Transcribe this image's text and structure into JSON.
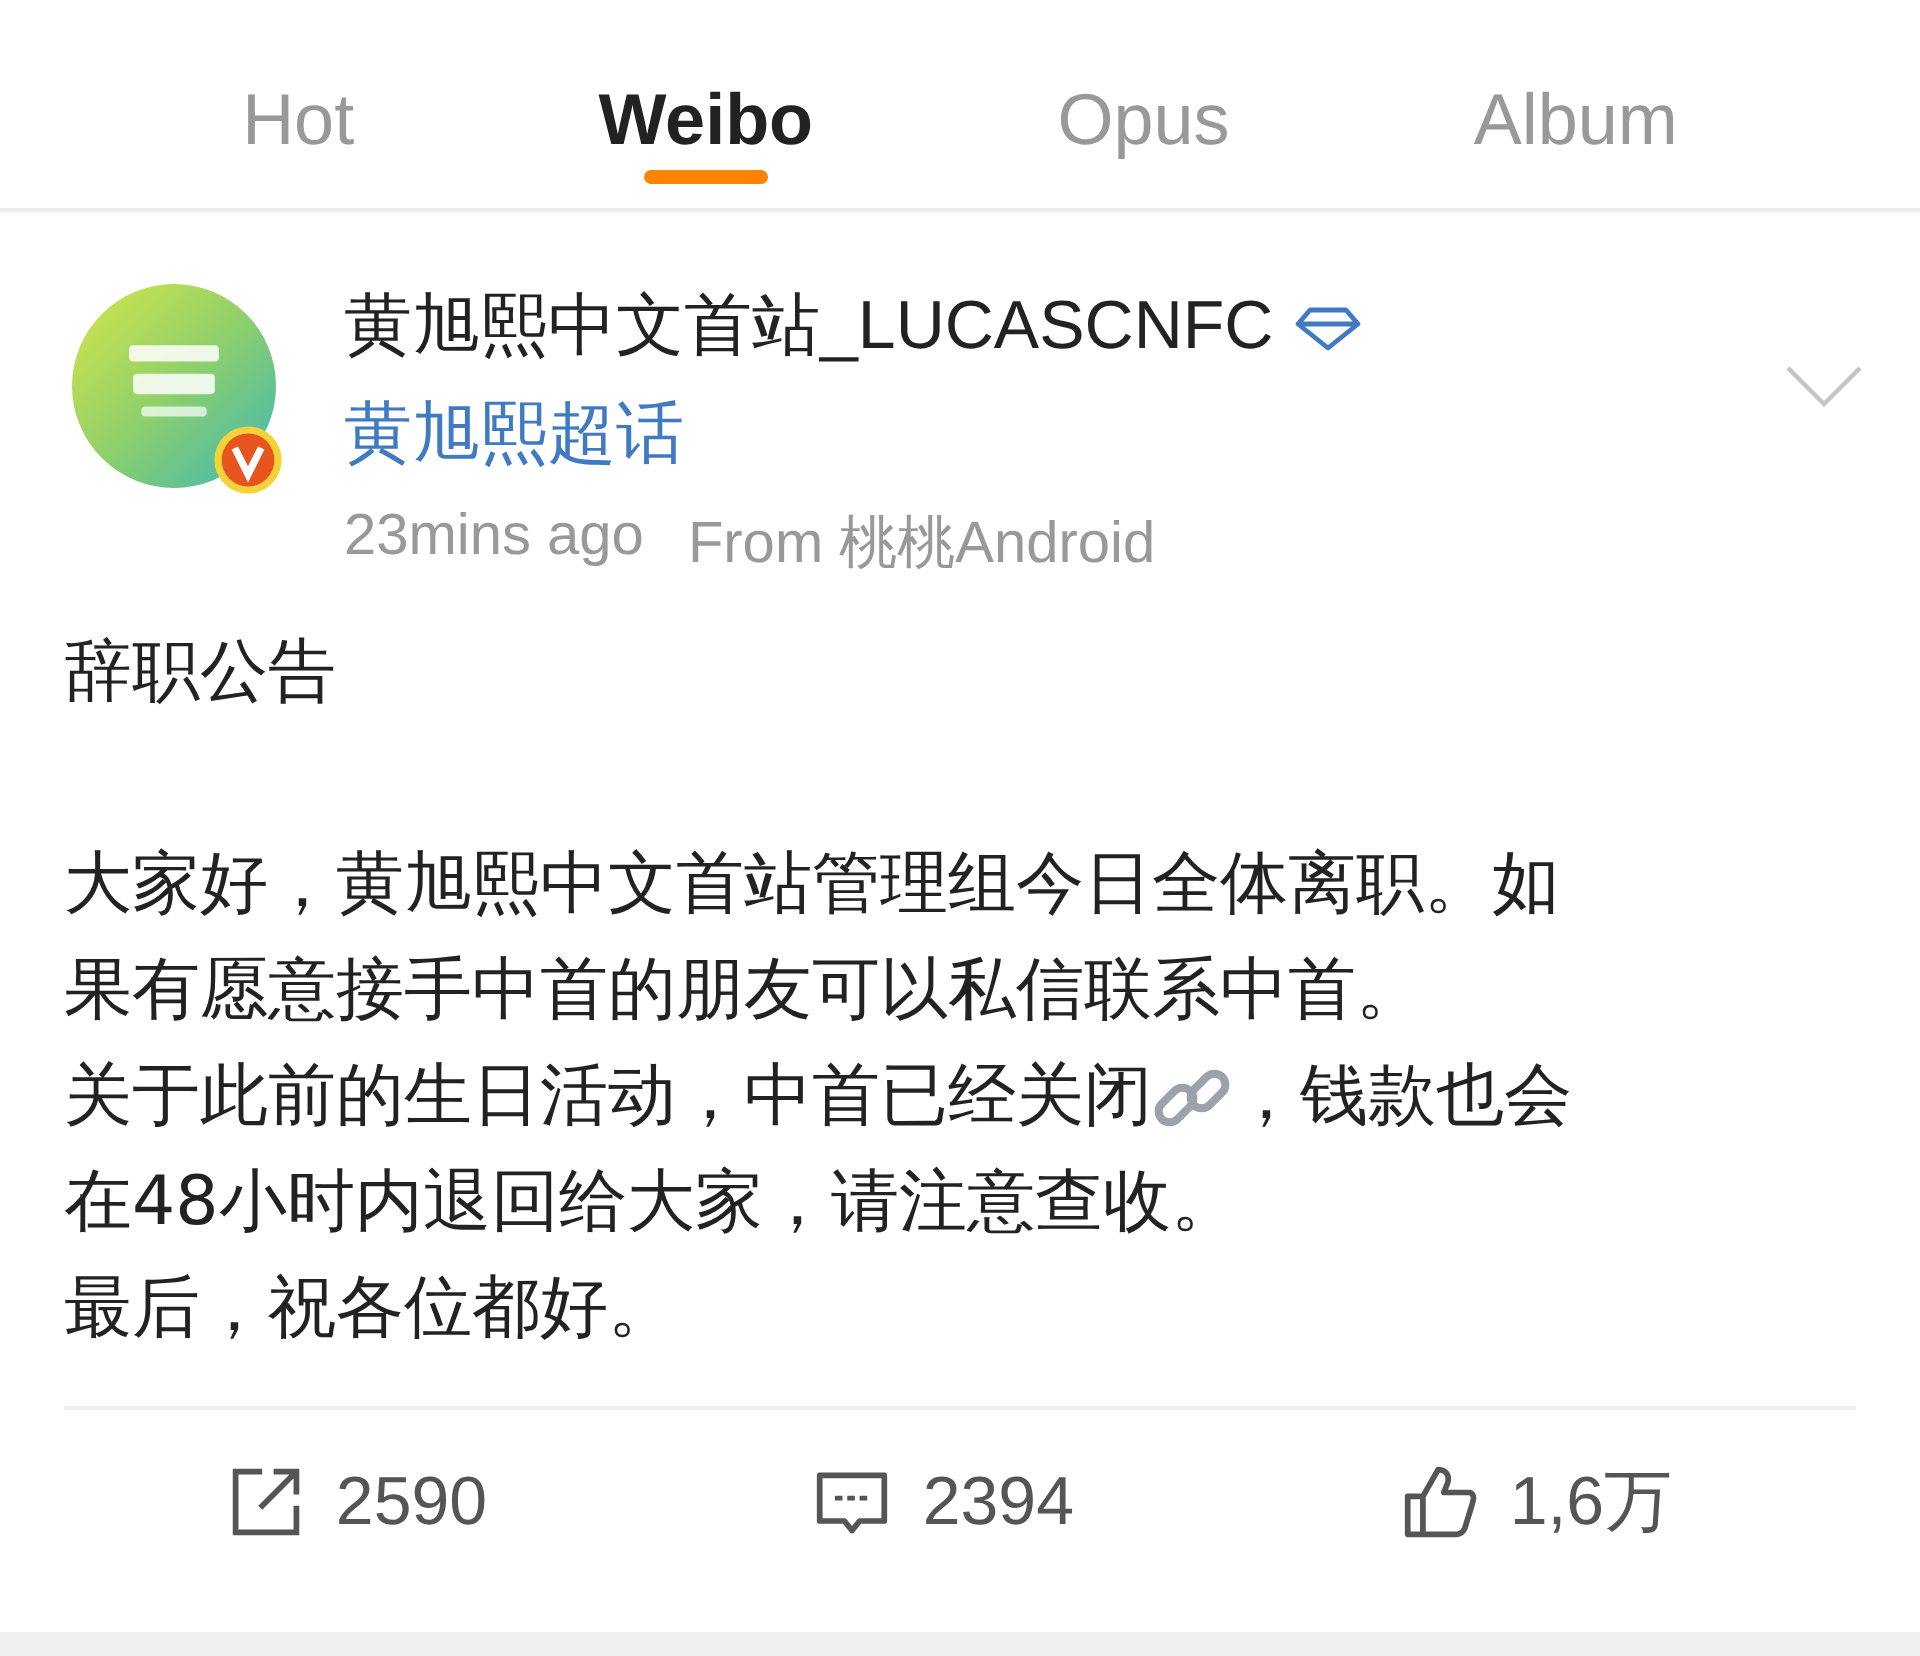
{
  "tabs": [
    {
      "label": "Hot",
      "selected": false
    },
    {
      "label": "Weibo",
      "selected": true
    },
    {
      "label": "Opus",
      "selected": false
    },
    {
      "label": "Album",
      "selected": false
    }
  ],
  "post": {
    "author": "黄旭熙中文首站_LUCASCNFC",
    "verified": true,
    "topic": "黄旭熙超话",
    "time": "23mins ago",
    "source": "From 桃桃Android",
    "paragraphs": [
      [
        {
          "text": "辞职公告"
        }
      ],
      [
        {
          "text": "大家好，黄旭熙中文首站管理组今日全体离职。如"
        },
        {
          "text": "果有愿意接手中首的朋友可以私信联系中首。"
        },
        {
          "text": "关于此前的生日活动，中首已经关闭",
          "link_icon": true,
          "after": "，钱款也会"
        },
        {
          "text": "在48小时内退回给大家，请注意查收。"
        },
        {
          "text": "最后，祝各位都好。"
        }
      ]
    ]
  },
  "actions": [
    {
      "kind": "repost",
      "count": "2590"
    },
    {
      "kind": "comment",
      "count": "2394"
    },
    {
      "kind": "like",
      "count": "1,6万"
    }
  ]
}
